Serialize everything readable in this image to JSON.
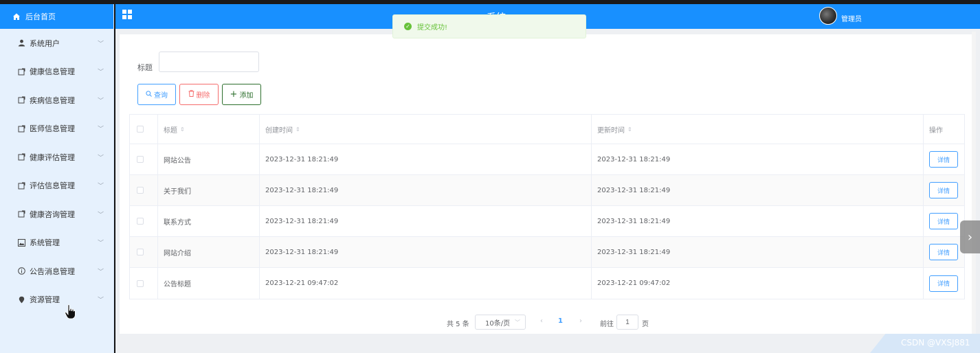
{
  "sidebar": {
    "home_label": "后台首页",
    "items": [
      {
        "label": "系统用户",
        "icon": "user-icon"
      },
      {
        "label": "健康信息管理",
        "icon": "doc-icon"
      },
      {
        "label": "疾病信息管理",
        "icon": "doc-icon"
      },
      {
        "label": "医师信息管理",
        "icon": "doc-icon"
      },
      {
        "label": "健康评估管理",
        "icon": "doc-icon"
      },
      {
        "label": "评估信息管理",
        "icon": "doc-icon"
      },
      {
        "label": "健康咨询管理",
        "icon": "doc-icon"
      },
      {
        "label": "系统管理",
        "icon": "picture-icon"
      },
      {
        "label": "公告消息管理",
        "icon": "info-icon"
      },
      {
        "label": "资源管理",
        "icon": "location-icon"
      }
    ]
  },
  "header": {
    "title": "系统",
    "user_name": "管理员"
  },
  "toast": {
    "message": "提交成功!",
    "color": "#67c23a"
  },
  "search": {
    "label": "标题",
    "value": "",
    "placeholder": ""
  },
  "toolbar": {
    "query_label": "查询",
    "delete_label": "删除",
    "add_label": "添加"
  },
  "table": {
    "headers": {
      "title": "标题",
      "created": "创建时间",
      "updated": "更新时间",
      "ops": "操作"
    },
    "rows": [
      {
        "title": "网站公告",
        "created": "2023-12-31 18:21:49",
        "updated": "2023-12-31 18:21:49",
        "action": "详情"
      },
      {
        "title": "关于我们",
        "created": "2023-12-31 18:21:49",
        "updated": "2023-12-31 18:21:49",
        "action": "详情"
      },
      {
        "title": "联系方式",
        "created": "2023-12-31 18:21:49",
        "updated": "2023-12-31 18:21:49",
        "action": "详情"
      },
      {
        "title": "网站介绍",
        "created": "2023-12-31 18:21:49",
        "updated": "2023-12-31 18:21:49",
        "action": "详情"
      },
      {
        "title": "公告标题",
        "created": "2023-12-21 09:47:02",
        "updated": "2023-12-21 09:47:02",
        "action": "详情"
      }
    ]
  },
  "pagination": {
    "total": "共 5 条",
    "page_size": "10条/页",
    "current_page": "1",
    "goto_label": "前往",
    "goto_value": "1",
    "page_unit": "页"
  },
  "watermark": "CSDN @VXSJ881",
  "colors": {
    "primary": "#1890ff",
    "danger": "#f56c6c",
    "success": "#67c23a"
  }
}
